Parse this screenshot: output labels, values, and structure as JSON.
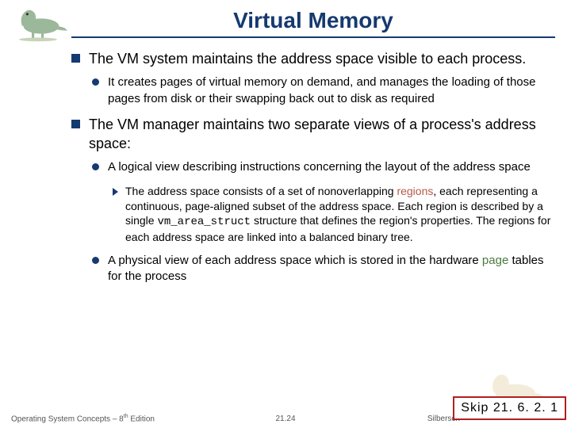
{
  "title": "Virtual Memory",
  "bullets": {
    "b1a": "The VM system maintains the address space visible to each process.",
    "b2a": "It creates pages of virtual memory on demand, and manages the loading of those pages from disk or their swapping back out to disk as required",
    "b1b": "The VM manager maintains two separate views of a process's address space:",
    "b2b": "A logical view describing instructions concerning the layout of the address space",
    "b3a_pre": "The address space consists of a set of nonoverlapping ",
    "b3a_region": "regions",
    "b3a_mid": ", each representing a continuous, page-aligned subset of the address space. Each region is described by a single ",
    "b3a_code": "vm_area_struct",
    "b3a_post": " structure that defines the region's properties. The regions for each address space are linked into a balanced binary tree.",
    "b2c_pre": "A physical view of each address space which is stored in the hardware ",
    "b2c_page": "page",
    "b2c_post": " tables for the process"
  },
  "footer": {
    "left_pre": "Operating System Concepts – 8",
    "left_sup": "th",
    "left_post": " Edition",
    "center": "21.24",
    "right": "Silbersch"
  },
  "skip": "Skip 21. 6. 2. 1"
}
